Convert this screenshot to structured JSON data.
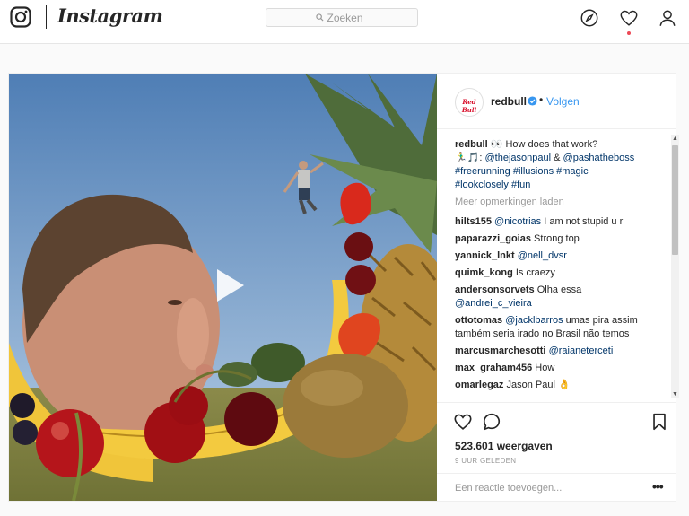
{
  "app": {
    "wordmark": "Instagram"
  },
  "search": {
    "placeholder": "Zoeken"
  },
  "colors": {
    "link": "#003569",
    "follow": "#3897f0",
    "notification_dot": "#ed4956",
    "verified": "#3897f0"
  },
  "nav": {
    "icons": [
      "compass-icon",
      "heart-icon",
      "profile-icon"
    ]
  },
  "post": {
    "account": {
      "username": "redbull",
      "avatar_text": "Red Bull",
      "follow_label": "Volgen",
      "separator": "•"
    },
    "caption": {
      "username": "redbull",
      "text_1": "👀 How does that work?",
      "text_2": "🏃‍♂️🎵: ",
      "mention_1": "@thejasonpaul",
      "amp": " & ",
      "mention_2": "@pashatheboss",
      "hashtags": [
        "#freerunning",
        "#illusions",
        "#magic",
        "#lookclosely",
        "#fun"
      ]
    },
    "load_more": "Meer opmerkingen laden",
    "comments": [
      {
        "user": "hilts155",
        "mention": "@nicotrias",
        "text": " I am not stupid u r"
      },
      {
        "user": "paparazzi_goias",
        "mention": "",
        "text": "Strong top"
      },
      {
        "user": "yannick_lnkt",
        "mention": "@nell_dvsr",
        "text": ""
      },
      {
        "user": "quimk_kong",
        "mention": "",
        "text": "Is craezy"
      },
      {
        "user": "andersonsorvets",
        "mention": "",
        "text": "Olha essa ",
        "mention_after": "@andrei_c_vieira"
      },
      {
        "user": "ottotomas",
        "mention": "@jacklbarros",
        "text": " umas pira assim também seria irado no Brasil não temos"
      },
      {
        "user": "marcusmarchesotti",
        "mention": "@raianeterceti",
        "text": ""
      },
      {
        "user": "max_graham456",
        "mention": "",
        "text": "How"
      },
      {
        "user": "omarlegaz",
        "mention": "",
        "text": "Jason Paul 👌"
      }
    ],
    "views": "523.601 weergaven",
    "timestamp": "9 UUR GELEDEN",
    "add_comment_placeholder": "Een reactie toevoegen...",
    "more_options": "•••"
  }
}
